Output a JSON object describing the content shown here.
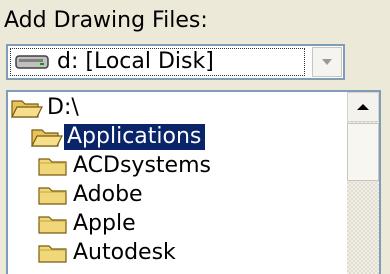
{
  "header": {
    "label": "Add Drawing Files:"
  },
  "drive_combo": {
    "selected": "d: [Local Disk]",
    "icon": "hard-drive-icon"
  },
  "tree": {
    "items": [
      {
        "label": "D:\\",
        "icon": "open-folder-icon",
        "selected": false
      },
      {
        "label": "Applications",
        "icon": "open-folder-icon",
        "selected": true
      },
      {
        "label": "ACDsystems",
        "icon": "folder-icon",
        "selected": false
      },
      {
        "label": "Adobe",
        "icon": "folder-icon",
        "selected": false
      },
      {
        "label": "Apple",
        "icon": "folder-icon",
        "selected": false
      },
      {
        "label": "Autodesk",
        "icon": "folder-icon",
        "selected": false
      }
    ]
  },
  "colors": {
    "selection_bg": "#0a246a",
    "border": "#7f9db9",
    "window_bg": "#ece9d8"
  }
}
